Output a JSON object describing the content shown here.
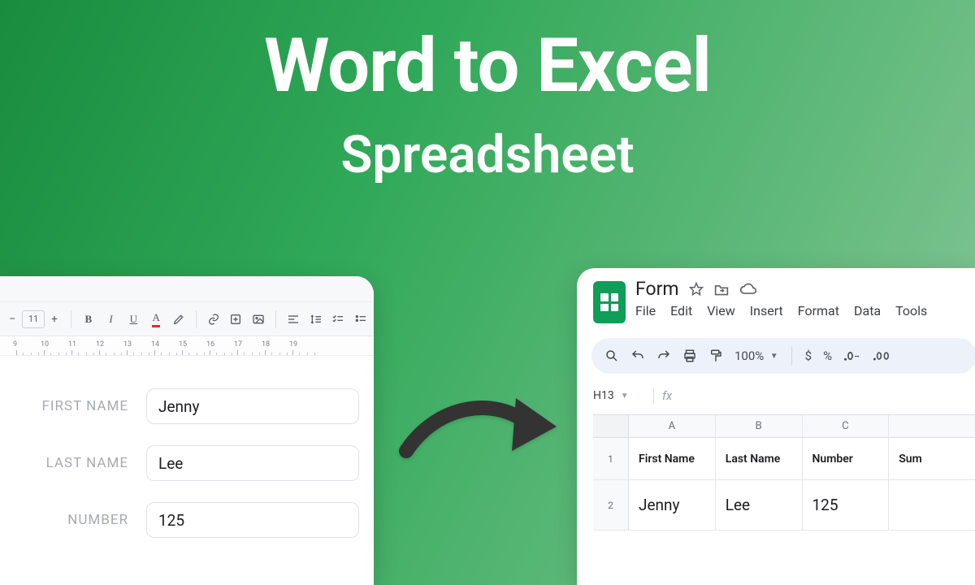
{
  "hero": {
    "title": "Word to Excel",
    "subtitle": "Spreadsheet"
  },
  "word": {
    "font_size": "11",
    "ruler": [
      "9",
      "10",
      "11",
      "12",
      "13",
      "14",
      "15",
      "16",
      "17",
      "18",
      "19"
    ],
    "fields": [
      {
        "label": "FIRST NAME",
        "value": "Jenny"
      },
      {
        "label": "LAST NAME",
        "value": "Lee"
      },
      {
        "label": "NUMBER",
        "value": "125"
      }
    ]
  },
  "sheets": {
    "doc_title": "Form",
    "menu": [
      "File",
      "Edit",
      "View",
      "Insert",
      "Format",
      "Data",
      "Tools"
    ],
    "zoom": "100%",
    "cell_ref": "H13",
    "fx_label": "fx",
    "currency": "$",
    "percent": "%",
    "columns": [
      "A",
      "B",
      "C",
      ""
    ],
    "headers": [
      "First Name",
      "Last Name",
      "Number",
      "Sum"
    ],
    "row": [
      "Jenny",
      "Lee",
      "125",
      ""
    ]
  }
}
